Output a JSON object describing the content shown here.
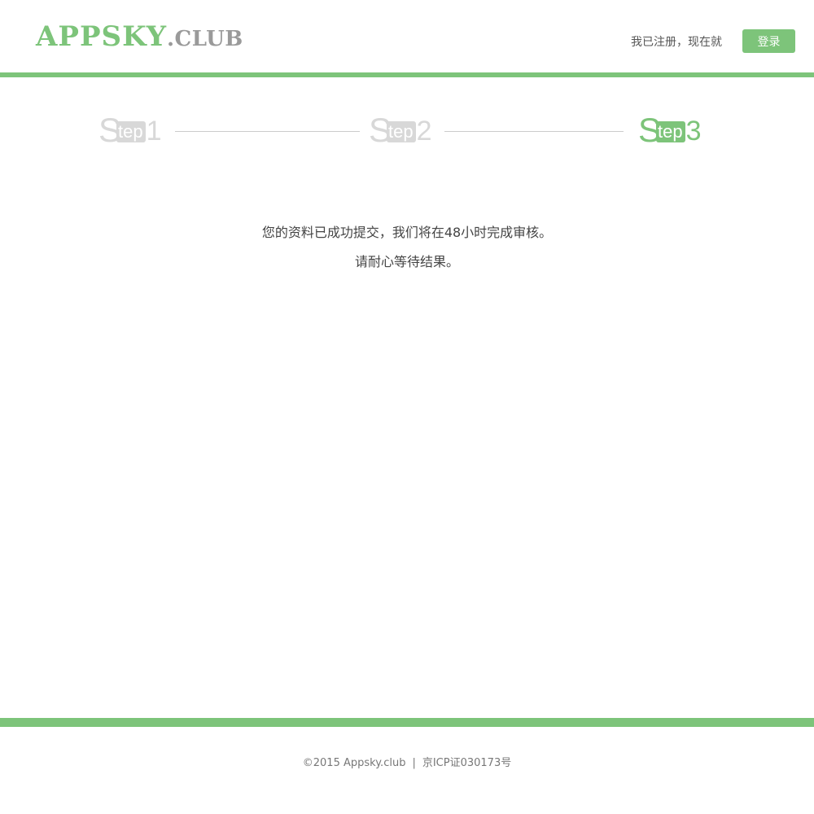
{
  "header": {
    "logo_main": "APPSKY",
    "logo_sub": ".CLUB",
    "login_hint": "我已注册，现在就",
    "login_button": "登录"
  },
  "steps": [
    {
      "prefix": "S",
      "suffix": "tep",
      "number": "1",
      "state": "inactive"
    },
    {
      "prefix": "S",
      "suffix": "tep",
      "number": "2",
      "state": "inactive"
    },
    {
      "prefix": "S",
      "suffix": "tep",
      "number": "3",
      "state": "active"
    }
  ],
  "message": {
    "line1": "您的资料已成功提交，我们将在48小时完成审核。",
    "line2": "请耐心等待结果。"
  },
  "footer": {
    "copyright": "©2015 Appsky.club",
    "separator": "|",
    "icp": "京ICP证030173号"
  },
  "colors": {
    "accent": "#7dc47a",
    "inactive_step": "#d8d8d8"
  }
}
